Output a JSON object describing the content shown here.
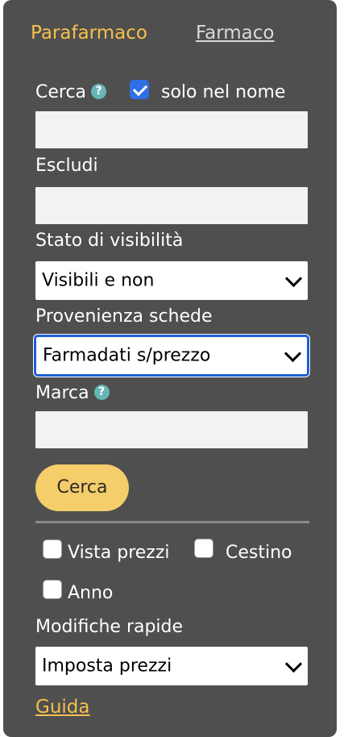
{
  "tabs": {
    "active_label": "Parafarmaco",
    "inactive_label": "Farmaco"
  },
  "search": {
    "label": "Cerca",
    "help_glyph": "?",
    "name_only_label": "solo nel nome",
    "name_only_checked": true,
    "value": ""
  },
  "exclude": {
    "label": "Escludi",
    "value": ""
  },
  "visibility": {
    "label": "Stato di visibilità",
    "selected": "Visibili e non"
  },
  "source": {
    "label": "Provenienza schede",
    "selected": "Farmadati s/prezzo"
  },
  "brand": {
    "label": "Marca",
    "help_glyph": "?",
    "value": ""
  },
  "search_button": {
    "label": "Cerca"
  },
  "options": {
    "prices_view_label": "Vista prezzi",
    "prices_view_checked": false,
    "trash_label": "Cestino",
    "trash_checked": false,
    "year_label": "Anno",
    "year_checked": false
  },
  "quick_edit": {
    "label": "Modifiche rapide",
    "selected": "Imposta prezzi"
  },
  "guide": {
    "label": "Guida"
  },
  "colors": {
    "panel_bg": "#4f4f4f",
    "accent": "#f5c04d",
    "button_bg": "#f5cd6a",
    "help_icon": "#67b6b8",
    "checkbox_checked": "#2f6fe6",
    "focus_ring": "#1e5fd6"
  }
}
